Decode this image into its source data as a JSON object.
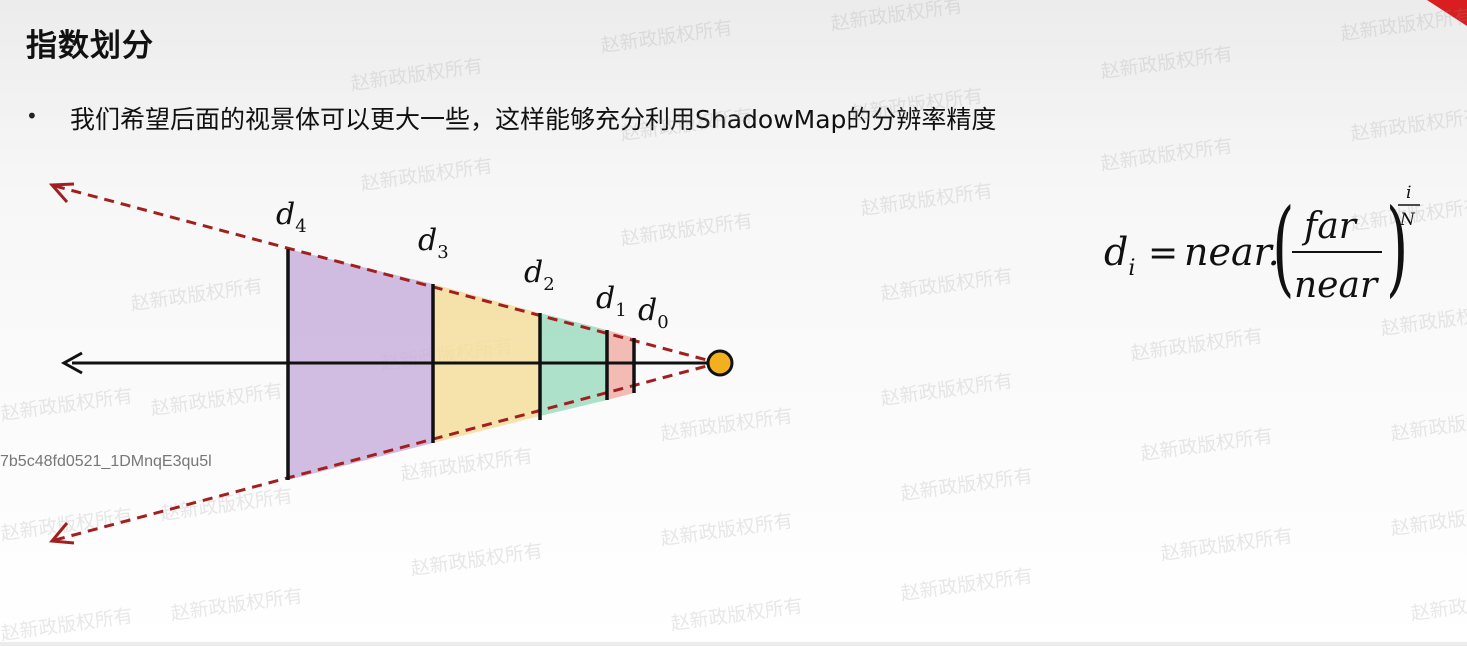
{
  "slide": {
    "title": "指数划分",
    "bullets": [
      "我们希望后面的视景体可以更大一些，这样能够充分利用ShadowMap的分辨率精度"
    ],
    "video_id": "7b5c48fd0521_1DMnqE3qu5l",
    "watermark_text": "赵新政版权所有"
  },
  "diagram": {
    "split_labels": [
      {
        "base": "d",
        "sub": "4"
      },
      {
        "base": "d",
        "sub": "3"
      },
      {
        "base": "d",
        "sub": "2"
      },
      {
        "base": "d",
        "sub": "1"
      },
      {
        "base": "d",
        "sub": "0"
      }
    ],
    "region_colors": [
      "#c8b2dc",
      "#f5de9e",
      "#9fdcc0",
      "#f0b0a8"
    ],
    "arrow_color": "#a31f1f",
    "camera_color": "#f2b01e"
  },
  "formula": {
    "lhs_base": "d",
    "lhs_sub": "i",
    "equals": "=",
    "near_term": "near.",
    "numerator": "far",
    "denominator": "near",
    "exp_numerator": "i",
    "exp_denominator": "N"
  }
}
